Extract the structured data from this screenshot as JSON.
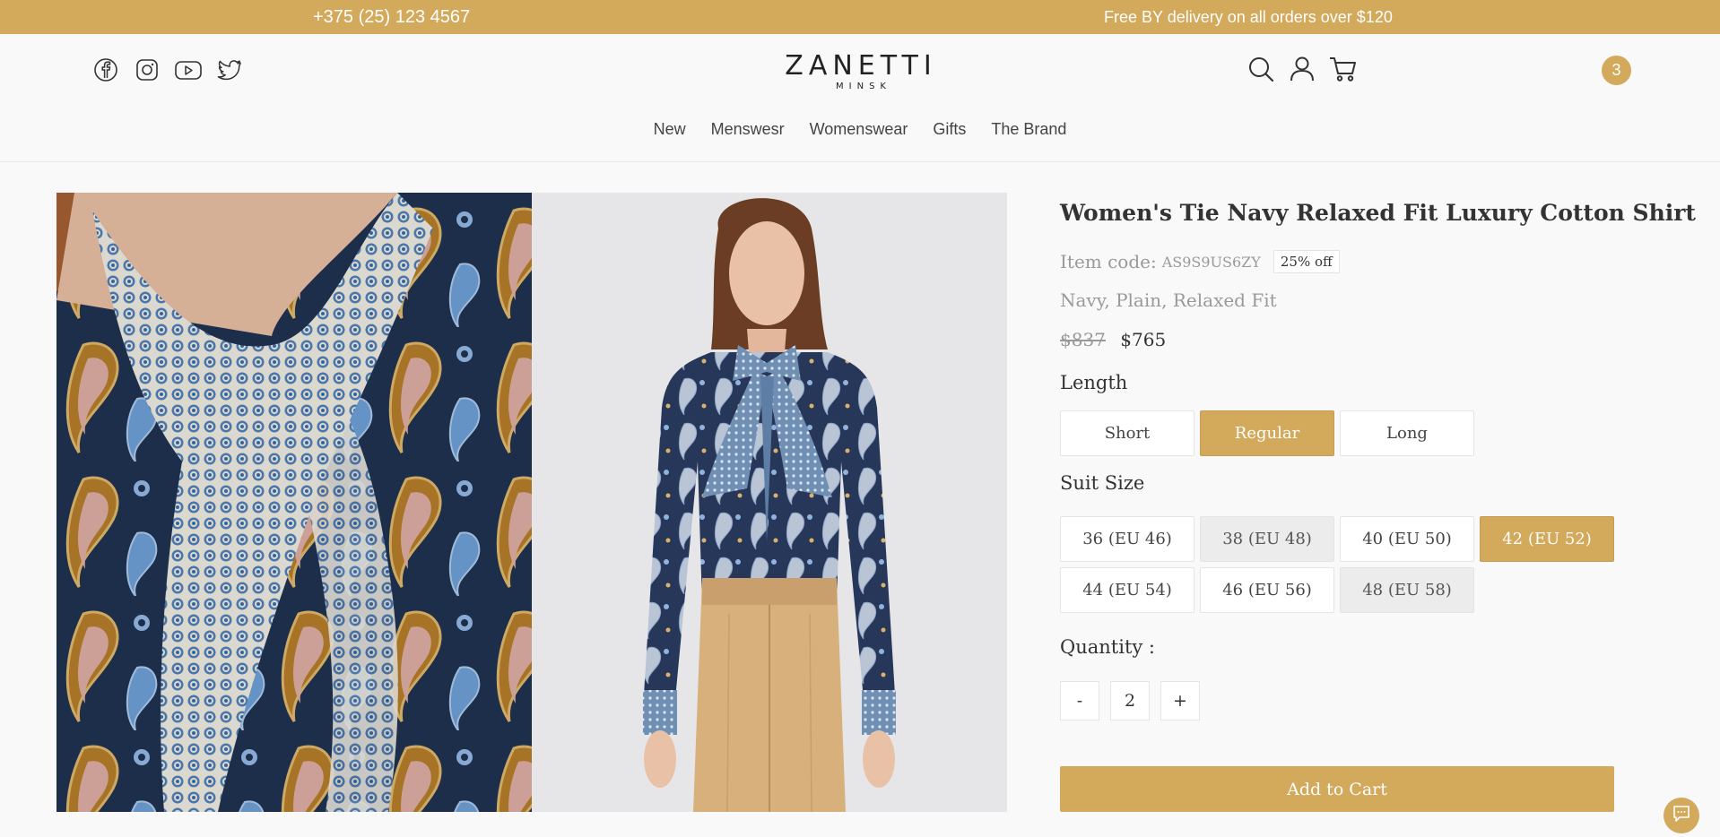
{
  "topbar": {
    "phone": "+375 (25) 123 4567",
    "promo": "Free BY delivery on all orders over $120"
  },
  "header": {
    "social_icons": [
      "facebook-icon",
      "instagram-icon",
      "youtube-icon",
      "twitter-icon"
    ],
    "logo_name": "ZANETTI",
    "logo_city": "MINSK",
    "action_icons": [
      "search-icon",
      "user-icon",
      "cart-icon"
    ],
    "cart_count": "3"
  },
  "nav": {
    "items": [
      "New",
      "Menswesr",
      "Womenswear",
      "Gifts",
      "The Brand"
    ]
  },
  "product": {
    "title": "Women's Tie Navy Relaxed Fit Luxury Cotton Shirt",
    "item_code_label": "Item code:",
    "item_code": "AS9S9US6ZY",
    "discount": "25% off",
    "meta": "Navy, Plain, Relaxed Fit",
    "old_price": "$837",
    "price": "$765",
    "length_label": "Length",
    "lengths": [
      "Short",
      "Regular",
      "Long"
    ],
    "selected_length": "Regular",
    "size_label": "Suit Size",
    "sizes": [
      "36 (EU 46)",
      "38 (EU 48)",
      "40 (EU 50)",
      "42 (EU 52)",
      "44 (EU 54)",
      "46 (EU 56)",
      "48 (EU 58)"
    ],
    "selected_size": "42 (EU 52)",
    "quantity_label": "Quantity :",
    "quantity_minus": "-",
    "quantity": "2",
    "quantity_plus": "+",
    "add_to_cart": "Add to Cart"
  },
  "colors": {
    "accent": "#d3a95c",
    "background": "#f9f9f9",
    "navy": "#23344f",
    "beige_pants": "#d7b07c"
  }
}
